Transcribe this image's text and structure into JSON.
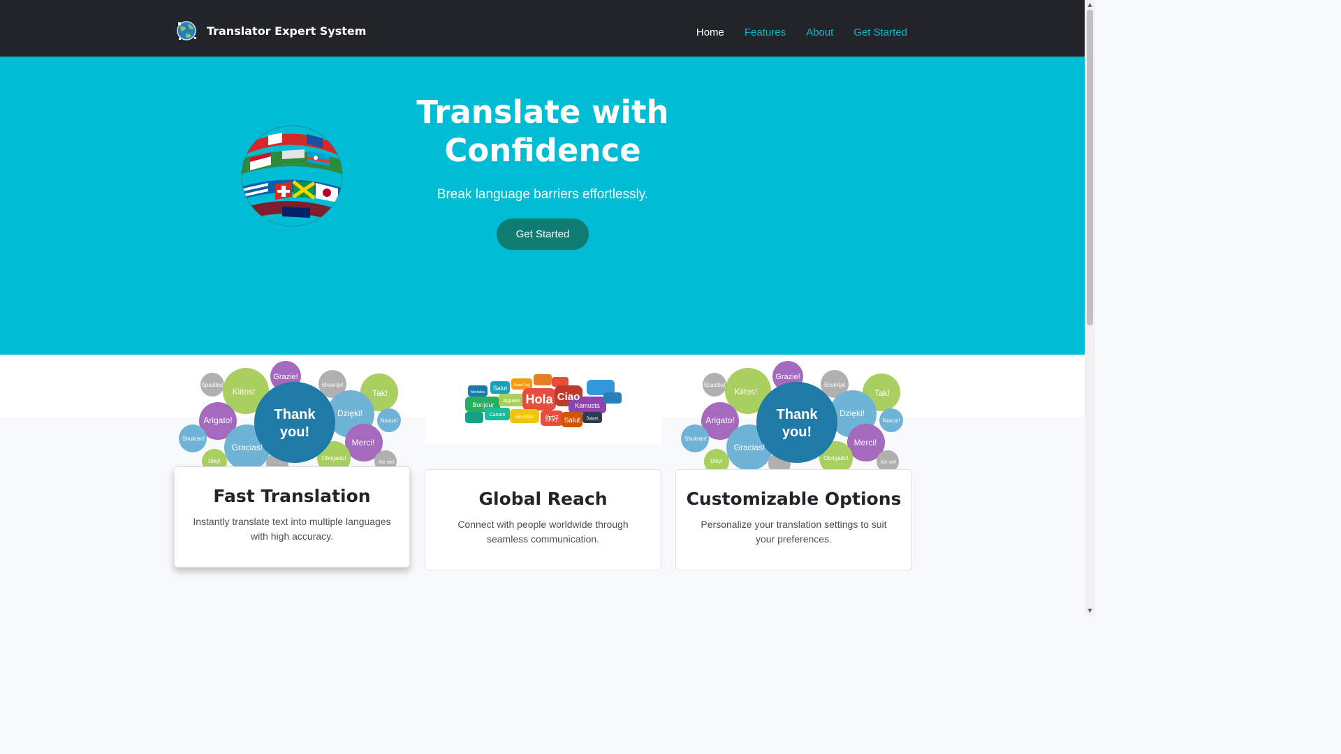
{
  "navbar": {
    "brand": "Translator Expert System",
    "logo_icon": "globe-logo-icon",
    "links": [
      "Home",
      "Features",
      "About",
      "Get Started"
    ]
  },
  "hero": {
    "title": "Translate with Confidence",
    "subtitle": "Break language barriers effortlessly.",
    "button": "Get Started",
    "image_icon": "flag-globe-icon"
  },
  "features": [
    {
      "title": "Fast Translation",
      "text": "Instantly translate text into multiple languages with high accuracy.",
      "image": {
        "center": "Thank you!",
        "bubbles": [
          "Spasiba!",
          "Kiitos!",
          "Grazie!",
          "Shukrija!",
          "Tak!",
          "Arigato!",
          "Dzięki!",
          "Novus!",
          "Shukran!",
          "Gracias!",
          "Merci!",
          "Diky!",
          "Obrigado!",
          "Xie xie!"
        ]
      }
    },
    {
      "title": "Global Reach",
      "text": "Connect with people worldwide through seamless communication.",
      "image": {
        "bubbles": [
          "Merhaba",
          "Salut",
          "Guten Tag",
          "Bonjour",
          "Здраво",
          "Hola",
          "Ciao",
          "Kamusta",
          "Canam",
          "xin chào",
          "你好",
          "Salut",
          "Salam"
        ]
      }
    },
    {
      "title": "Customizable Options",
      "text": "Personalize your translation settings to suit your preferences.",
      "image": {
        "center": "Thank you!",
        "bubbles": [
          "Spasiba!",
          "Kiitos!",
          "Grazie!",
          "Shukrija!",
          "Tak!",
          "Arigato!",
          "Dzięki!",
          "Novus!",
          "Shukran!",
          "Gracias!",
          "Merci!",
          "Diky!",
          "Obrigado!",
          "Xie xie!"
        ]
      }
    }
  ],
  "colors": {
    "navbar": "#212529",
    "hero": "#00bcd4",
    "button": "#0f7c72",
    "link": "#17b3d1"
  }
}
